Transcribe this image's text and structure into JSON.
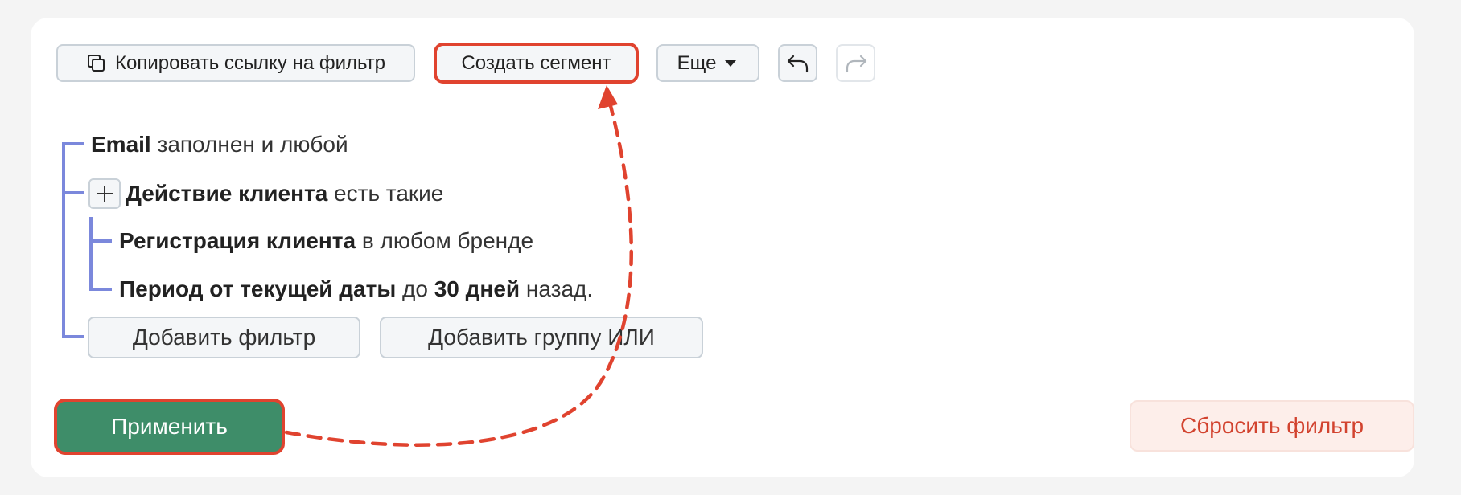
{
  "toolbar": {
    "copy_link_label": "Копировать ссылку на фильтр",
    "create_segment_label": "Создать сегмент",
    "more_label": "Еще"
  },
  "tree": {
    "email": {
      "field": "Email",
      "condition": "заполнен и любой"
    },
    "action": {
      "field": "Действие клиента",
      "condition": "есть такие"
    },
    "registration": {
      "field": "Регистрация клиента",
      "condition": "в любом бренде"
    },
    "period": {
      "field": "Период от текущей даты",
      "mid": "до",
      "value": "30 дней",
      "tail": "назад."
    }
  },
  "add_filter_label": "Добавить фильтр",
  "add_group_label": "Добавить группу ИЛИ",
  "apply_label": "Применить",
  "reset_label": "Сбросить фильтр",
  "colors": {
    "accent_green": "#3e8d69",
    "highlight_red": "#e0432f",
    "tree_line": "#7b88dc",
    "reset_text": "#d2432f",
    "reset_bg": "#fdeeea"
  }
}
